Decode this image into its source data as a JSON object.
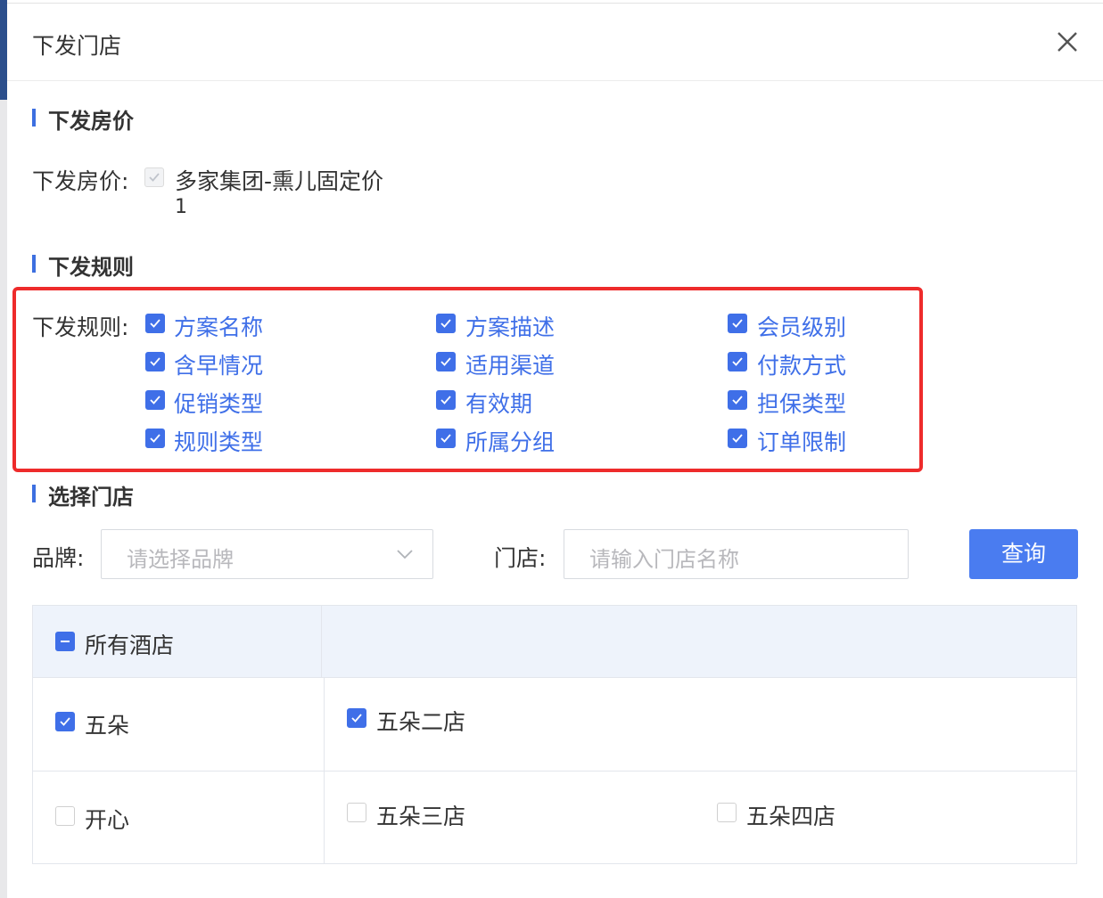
{
  "dialog": {
    "title": "下发门店"
  },
  "price_section": {
    "heading": "下发房价",
    "label": "下发房价:",
    "item_line1": "多家集团-熏儿固定价",
    "item_line2": "1"
  },
  "rules_section": {
    "heading": "下发规则",
    "label": "下发规则:",
    "items": [
      "方案名称",
      "方案描述",
      "会员级别",
      "含早情况",
      "适用渠道",
      "付款方式",
      "促销类型",
      "有效期",
      "担保类型",
      "规则类型",
      "所属分组",
      "订单限制"
    ]
  },
  "store_section": {
    "heading": "选择门店",
    "brand_label": "品牌:",
    "brand_placeholder": "请选择品牌",
    "store_label": "门店:",
    "store_placeholder": "请输入门店名称",
    "query_button": "查询",
    "all_hotels": "所有酒店",
    "brands": [
      {
        "name": "五朵",
        "checked": true,
        "stores": [
          {
            "name": "五朵二店",
            "checked": true
          }
        ]
      },
      {
        "name": "开心",
        "checked": false,
        "stores": [
          {
            "name": "五朵三店",
            "checked": false
          },
          {
            "name": "五朵四店",
            "checked": false
          }
        ]
      }
    ]
  },
  "colors": {
    "accent": "#3f6fe8",
    "highlight": "#ee2b2b"
  }
}
